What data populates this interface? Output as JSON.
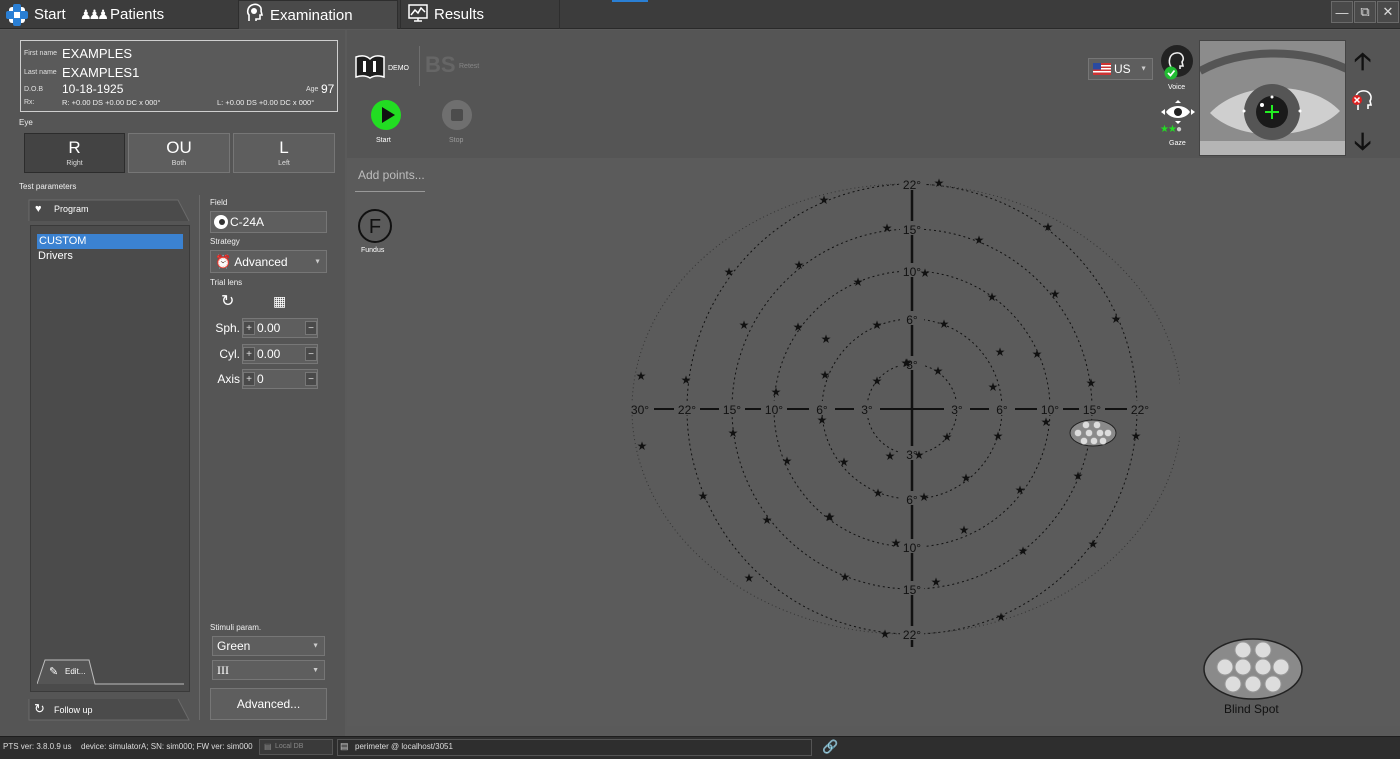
{
  "tabs": [
    {
      "label": "Start"
    },
    {
      "label": "Patients"
    },
    {
      "label": "Examination"
    },
    {
      "label": "Results"
    }
  ],
  "patient": {
    "first_name_label": "First name",
    "first_name": "EXAMPLES",
    "last_name_label": "Last name",
    "last_name": "EXAMPLES1",
    "dob_label": "D.O.B",
    "dob": "10-18-1925",
    "age_label": "Age",
    "age": "97",
    "rx_label": "Rx:",
    "rx_right": "R: +0.00 DS +0.00 DC x 000°",
    "rx_left": "L: +0.00 DS +0.00 DC x 000°"
  },
  "eye": {
    "section_label": "Eye",
    "buttons": [
      {
        "big": "R",
        "small": "Right"
      },
      {
        "big": "OU",
        "small": "Both"
      },
      {
        "big": "L",
        "small": "Left"
      }
    ]
  },
  "test_params": {
    "section_label": "Test parameters",
    "program_tab": "Program",
    "programs": [
      "CUSTOM",
      "Drivers"
    ],
    "edit_label": "Edit...",
    "follow_up_label": "Follow up",
    "field_label": "Field",
    "field_value": "C-24A",
    "strategy_label": "Strategy",
    "strategy_value": "Advanced",
    "trial_lens_label": "Trial lens",
    "sph_label": "Sph.",
    "sph_value": "0.00",
    "cyl_label": "Cyl.",
    "cyl_value": "0.00",
    "axis_label": "Axis",
    "axis_value": "0",
    "stimuli_label": "Stimuli param.",
    "color_value": "Green",
    "size_value": "III",
    "advanced_button": "Advanced..."
  },
  "toolbar": {
    "demo_label": "DEMO",
    "bs_label": "BS",
    "retest_label": "Retest",
    "start_label": "Start",
    "stop_label": "Stop",
    "add_points_placeholder": "Add points...",
    "fundus_label": "Fundus",
    "language": "US",
    "voice_label": "Voice",
    "gaze_label": "Gaze",
    "blind_spot_label": "Blind Spot"
  },
  "field_plot": {
    "ring_labels_deg": [
      3,
      6,
      10,
      15,
      22
    ],
    "x_axis_labels": [
      "30°",
      "22°",
      "15°",
      "10°",
      "6°",
      "3°",
      "3°",
      "6°",
      "10°",
      "15°",
      "22°"
    ],
    "y_axis_labels": [
      "22°",
      "15°",
      "10°",
      "6°",
      "3°",
      "3°",
      "6°",
      "10°",
      "15°",
      "22°"
    ]
  },
  "status": {
    "version": "PTS ver: 3.8.0.9 us",
    "device": "device: simulatorA; SN: sim000; FW ver: sim000",
    "db": "Local DB",
    "server": "perimeter @ localhost/3051"
  },
  "colors": {
    "accent_blue": "#3b82d1",
    "start_green": "#22dd22",
    "dark_bg": "#3c3c3c"
  }
}
